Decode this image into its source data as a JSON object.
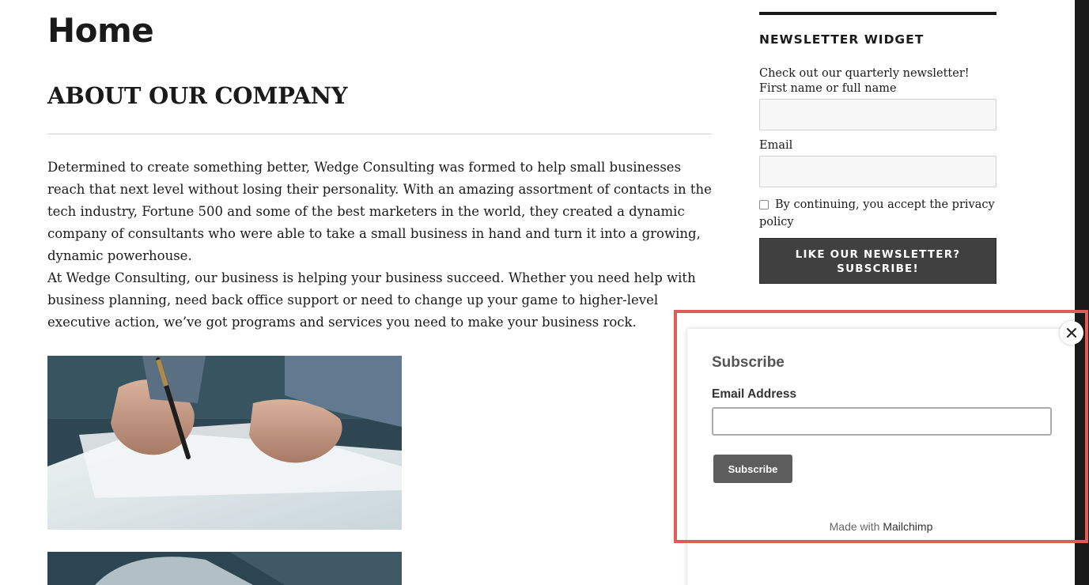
{
  "page": {
    "title": "Home",
    "section_heading": "ABOUT OUR COMPANY",
    "paragraphs": [
      "Determined to create something better, Wedge Consulting was formed to help small businesses reach that next level without losing their personality. With an amazing assortment of contacts in the tech industry, Fortune 500 and some of the best marketers in the world, they created a dynamic company of consultants who were able to take a small business in hand and turn it into a growing, dynamic powerhouse.",
      "At Wedge Consulting, our business is helping your business succeed. Whether you need help with business planning, need back office support or need to change up your game to higher-level executive action, we’ve got programs and services you need to make your business rock."
    ]
  },
  "sidebar": {
    "widget_title": "NEWSLETTER WIDGET",
    "intro": "Check out our quarterly newsletter!",
    "name_label": "First name or full name",
    "email_label": "Email",
    "consent": "By continuing, you accept the privacy policy",
    "submit_label": "LIKE OUR NEWSLETTER?  SUBSCRIBE!"
  },
  "popup": {
    "title": "Subscribe",
    "email_label": "Email Address",
    "button_label": "Subscribe",
    "footer_prefix": "Made with",
    "footer_brand": "Mailchimp",
    "close_icon": "close-icon"
  },
  "colors": {
    "highlight": "#e15b5b",
    "button_dark": "#404040",
    "popup_button": "#5d5d5d"
  }
}
